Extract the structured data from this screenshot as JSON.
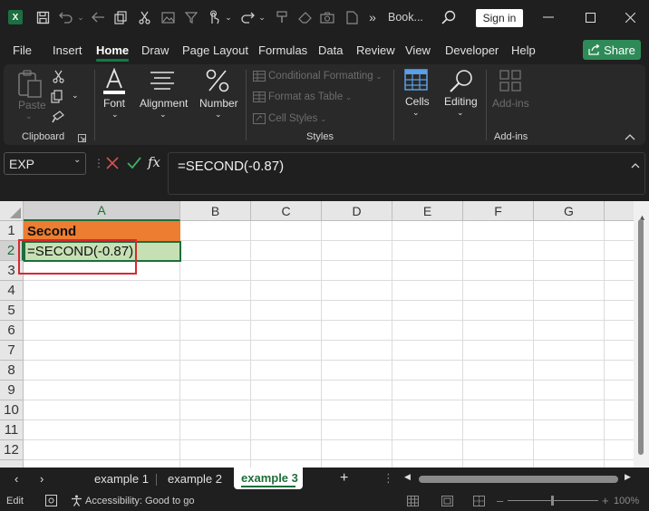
{
  "titlebar": {
    "app_icon": "X",
    "overflow": "»",
    "doc_title": "Book...",
    "sign_in": "Sign in"
  },
  "menu": {
    "tabs": [
      "File",
      "Insert",
      "Home",
      "Draw",
      "Page Layout",
      "Formulas",
      "Data",
      "Review",
      "View",
      "Developer",
      "Help"
    ],
    "active": "Home",
    "share": "Share"
  },
  "ribbon": {
    "paste": "Paste",
    "clipboard": "Clipboard",
    "font": "Font",
    "alignment": "Alignment",
    "number": "Number",
    "conditional_formatting": "Conditional Formatting",
    "format_as_table": "Format as Table",
    "cell_styles": "Cell Styles",
    "styles": "Styles",
    "cells": "Cells",
    "editing": "Editing",
    "addins": "Add-ins",
    "addins_group": "Add-ins"
  },
  "formula_bar": {
    "name_box": "EXP",
    "fx": "fx",
    "formula": "=SECOND(-0.87)"
  },
  "grid": {
    "columns": [
      "A",
      "B",
      "C",
      "D",
      "E",
      "F",
      "G"
    ],
    "rows": [
      "1",
      "2",
      "3",
      "4",
      "5",
      "6",
      "7",
      "8",
      "9",
      "10",
      "11",
      "12"
    ],
    "cells": {
      "A1": "Second",
      "A2": "=SECOND(-0.87)"
    },
    "header_fill": "#ed7d31",
    "active_fill": "#c6e0b4",
    "highlight_color": "#d9282f"
  },
  "sheets": {
    "tabs": [
      "example 1",
      "example 2",
      "example 3"
    ],
    "active": "example 3",
    "add": "+"
  },
  "status": {
    "mode": "Edit",
    "accessibility": "Accessibility: Good to go",
    "zoom": "100%"
  }
}
